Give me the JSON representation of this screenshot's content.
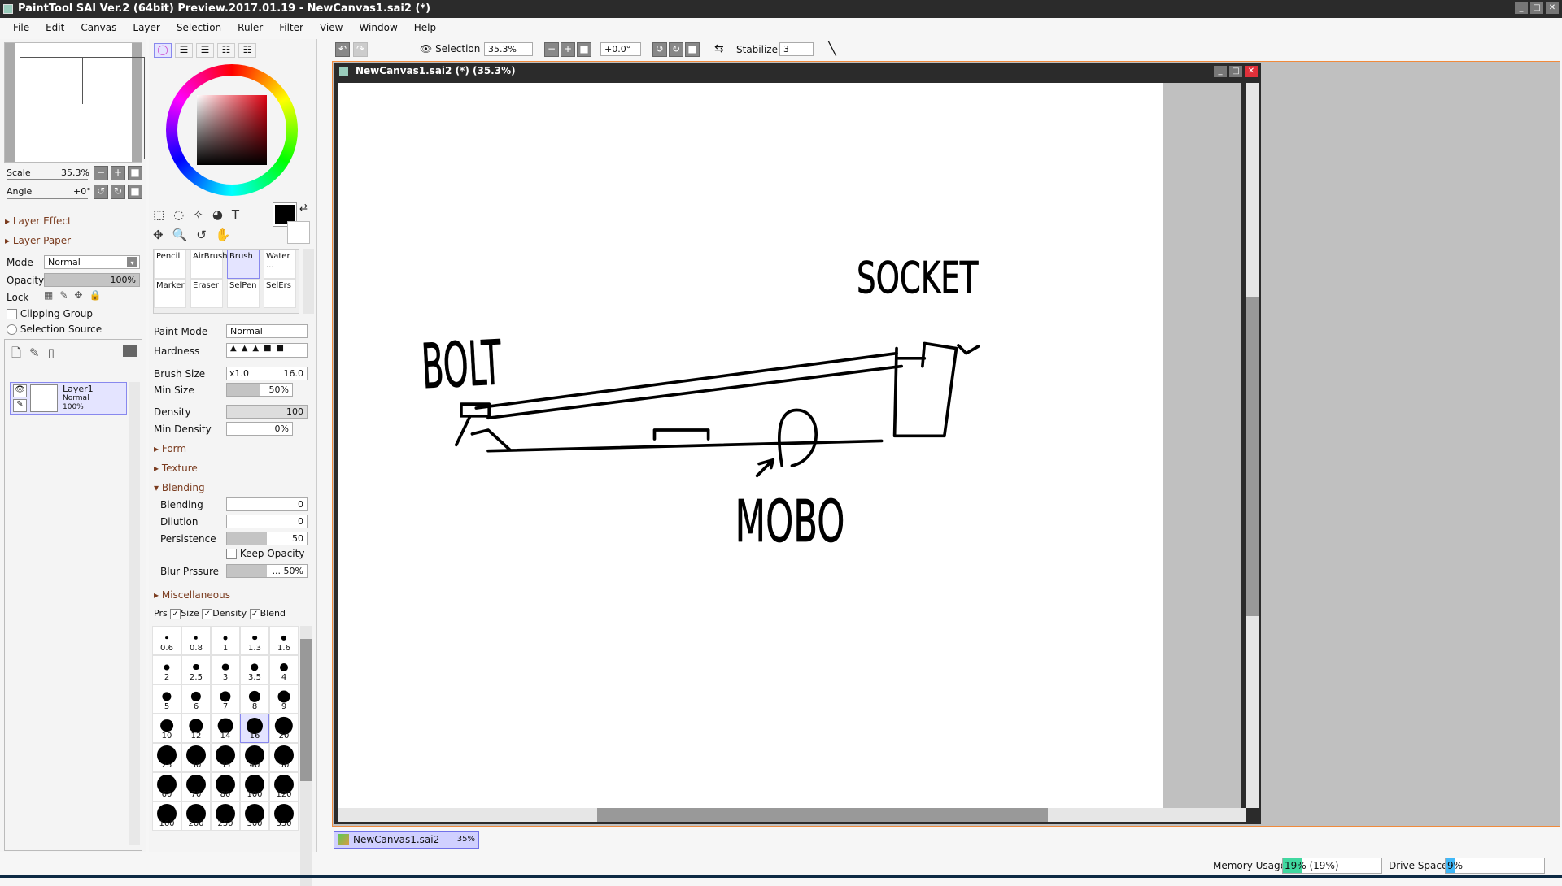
{
  "window": {
    "title": "PaintTool SAI Ver.2 (64bit) Preview.2017.01.19 - NewCanvas1.sai2 (*)"
  },
  "menu": [
    "File",
    "Edit",
    "Canvas",
    "Layer",
    "Selection",
    "Ruler",
    "Filter",
    "View",
    "Window",
    "Help"
  ],
  "navigator": {
    "scale_label": "Scale",
    "scale_value": "35.3%",
    "angle_label": "Angle",
    "angle_value": "+0°"
  },
  "layer_panel": {
    "layer_effect": "Layer Effect",
    "layer_paper": "Layer Paper",
    "mode_label": "Mode",
    "mode_value": "Normal",
    "opacity_label": "Opacity",
    "opacity_value": "100%",
    "opacity_percent": 100,
    "lock_label": "Lock",
    "clipping_group": "Clipping Group",
    "selection_source": "Selection Source",
    "layers": [
      {
        "name": "Layer1",
        "mode": "Normal",
        "opacity": "100%"
      }
    ]
  },
  "brush_tools": [
    {
      "label": "Pencil"
    },
    {
      "label": "AirBrush"
    },
    {
      "label": "Brush",
      "selected": true
    },
    {
      "label": "Water ..."
    },
    {
      "label": "Marker"
    },
    {
      "label": "Eraser"
    },
    {
      "label": "SelPen"
    },
    {
      "label": "SelErs"
    }
  ],
  "brush_settings": {
    "paint_mode_label": "Paint Mode",
    "paint_mode_value": "Normal",
    "hardness_label": "Hardness",
    "brush_size_label": "Brush Size",
    "brush_size_mult": "x1.0",
    "brush_size_value": "16.0",
    "min_size_label": "Min Size",
    "min_size_value": "50%",
    "min_size_percent": 50,
    "density_label": "Density",
    "density_value": "100",
    "min_density_label": "Min Density",
    "min_density_value": "0%",
    "form": "Form",
    "texture": "Texture",
    "blending_section": "Blending",
    "blending_label": "Blending",
    "blending_value": "0",
    "dilution_label": "Dilution",
    "dilution_value": "0",
    "persistence_label": "Persistence",
    "persistence_value": "50",
    "keep_opacity": "Keep Opacity",
    "blur_label": "Blur Prssure",
    "blur_value": "... 50%",
    "miscellaneous": "Miscellaneous",
    "prs_label": "Prs",
    "prs_size": "Size",
    "prs_density": "Density",
    "prs_blend": "Blend"
  },
  "brush_sizes": [
    "0.6",
    "0.8",
    "1",
    "1.3",
    "1.6",
    "2",
    "2.5",
    "3",
    "3.5",
    "4",
    "5",
    "6",
    "7",
    "8",
    "9",
    "10",
    "12",
    "14",
    "16",
    "20",
    "25",
    "30",
    "35",
    "40",
    "50",
    "60",
    "70",
    "80",
    "100",
    "120",
    "160",
    "200",
    "250",
    "300",
    "350"
  ],
  "selected_brush_size": "16",
  "toolbar": {
    "selection_label": "Selection",
    "zoom_value": "35.3%",
    "angle_value": "+0.0°",
    "stabilizer_label": "Stabilizer",
    "stabilizer_value": "3"
  },
  "canvas_window": {
    "title": "NewCanvas1.sai2 (*) (35.3%)"
  },
  "drawing_text": [
    "BOLT",
    "SOCKET",
    "MOBO"
  ],
  "tabs": [
    {
      "name": "NewCanvas1.sai2",
      "zoom": "35%"
    }
  ],
  "status": {
    "memory_label": "Memory Usage",
    "memory_value": "19% (19%)",
    "memory_percent": 19,
    "drive_label": "Drive Space",
    "drive_value": "9%",
    "drive_percent": 9
  },
  "colors": {
    "accent_orange": "#f08a3c",
    "selection_blue": "#e4e4ff",
    "memory_green": "#40d8a0",
    "drive_blue": "#40b8f8",
    "section_brown": "#7a3b1e"
  }
}
